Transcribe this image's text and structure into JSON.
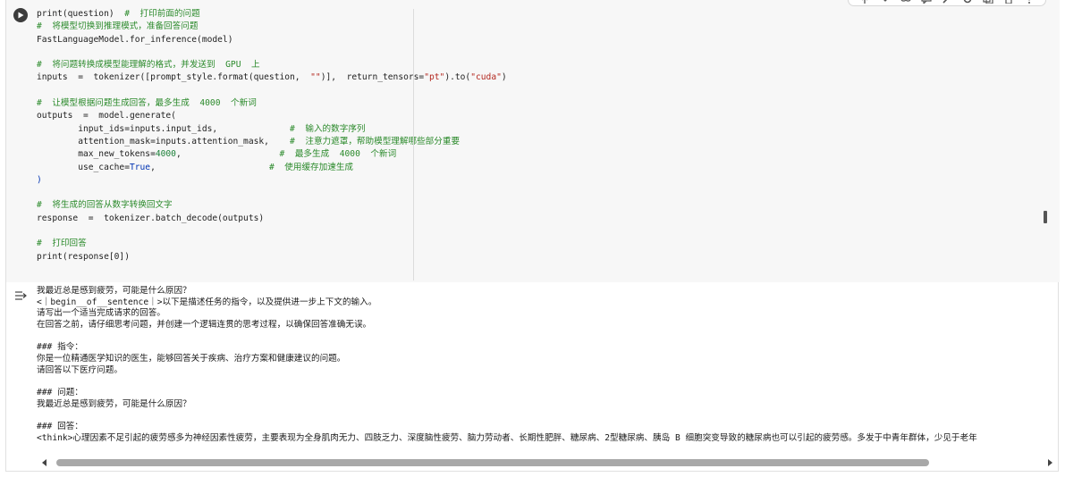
{
  "toolbar": {
    "icons": [
      "arrow-up-icon",
      "arrow-down-icon",
      "link-icon",
      "comment-icon",
      "edit-icon",
      "settings-icon",
      "mirror-icon",
      "delete-icon",
      "more-icon"
    ]
  },
  "code": {
    "lines": [
      [
        {
          "t": "print(question)  ",
          "c": ""
        },
        {
          "t": "#  打印前面的问题",
          "c": "cm"
        }
      ],
      [
        {
          "t": "#  将模型切换到推理模式，准备回答问题",
          "c": "cm"
        }
      ],
      [
        {
          "t": "FastLanguageModel.for_inference(model)",
          "c": ""
        }
      ],
      [
        {
          "t": "",
          "c": ""
        }
      ],
      [
        {
          "t": "#  将问题转换成模型能理解的格式，并发送到  GPU  上",
          "c": "cm"
        }
      ],
      [
        {
          "t": "inputs  =  tokenizer([prompt_style.format(question,  ",
          "c": ""
        },
        {
          "t": "\"\"",
          "c": "str"
        },
        {
          "t": ")],  return_tensors=",
          "c": ""
        },
        {
          "t": "\"pt\"",
          "c": "str"
        },
        {
          "t": ").to(",
          "c": ""
        },
        {
          "t": "\"cuda\"",
          "c": "str"
        },
        {
          "t": ")",
          "c": ""
        }
      ],
      [
        {
          "t": "",
          "c": ""
        }
      ],
      [
        {
          "t": "#  让模型根据问题生成回答，最多生成  4000  个新词",
          "c": "cm"
        }
      ],
      [
        {
          "t": "outputs  =  model.generate(",
          "c": ""
        }
      ],
      [
        {
          "t": "        input_ids=inputs.input_ids,              ",
          "c": ""
        },
        {
          "t": "#  输入的数字序列",
          "c": "cm"
        }
      ],
      [
        {
          "t": "        attention_mask=inputs.attention_mask,    ",
          "c": ""
        },
        {
          "t": "#  注意力遮罩，帮助模型理解哪些部分重要",
          "c": "cm"
        }
      ],
      [
        {
          "t": "        max_new_tokens=",
          "c": ""
        },
        {
          "t": "4000",
          "c": "num"
        },
        {
          "t": ",                   ",
          "c": ""
        },
        {
          "t": "#  最多生成  4000  个新词",
          "c": "cm"
        }
      ],
      [
        {
          "t": "        use_cache=",
          "c": ""
        },
        {
          "t": "True",
          "c": "kw"
        },
        {
          "t": ",                      ",
          "c": ""
        },
        {
          "t": "#  使用缓存加速生成",
          "c": "cm"
        }
      ],
      [
        {
          "t": ")",
          "c": "br"
        }
      ],
      [
        {
          "t": "",
          "c": ""
        }
      ],
      [
        {
          "t": "#  将生成的回答从数字转换回文字",
          "c": "cm"
        }
      ],
      [
        {
          "t": "response  =  tokenizer.batch_decode(outputs)",
          "c": ""
        }
      ],
      [
        {
          "t": "",
          "c": ""
        }
      ],
      [
        {
          "t": "#  打印回答",
          "c": "cm"
        }
      ],
      [
        {
          "t": "print(response[0])",
          "c": ""
        }
      ]
    ]
  },
  "output": {
    "lines": [
      "我最近总是感到疲劳，可能是什么原因？",
      "<｜begin__of__sentence｜>以下是描述任务的指令，以及提供进一步上下文的输入。",
      "请写出一个适当完成请求的回答。",
      "在回答之前，请仔细思考问题，并创建一个逻辑连贯的思考过程，以确保回答准确无误。",
      "",
      "### 指令：",
      "你是一位精通医学知识的医生，能够回答关于疾病、治疗方案和健康建议的问题。",
      "请回答以下医疗问题。",
      "",
      "### 问题：",
      "我最近总是感到疲劳，可能是什么原因？",
      "",
      "### 回答：",
      "<think>心理因素不足引起的疲劳感多为神经因素性疲劳，主要表现为全身肌肉无力、四肢乏力、深度脑性疲劳、脑力劳动者、长期性肥胖、糖尿病、2型糖尿病、胰岛 B 细胞突变导致的糖尿病也可以引起的疲劳感。多发于中青年群体，少见于老年"
    ]
  }
}
